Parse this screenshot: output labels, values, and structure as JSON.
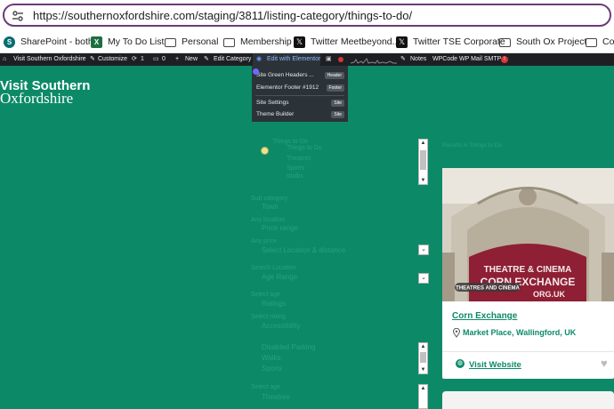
{
  "browser": {
    "url": "https://southernoxfordshire.com/staging/3811/listing-category/things-to-do/",
    "bookmarks": [
      {
        "label": "SharePoint - both",
        "icon": "sharepoint-icon"
      },
      {
        "label": "My To Do List",
        "icon": "excel-icon"
      },
      {
        "label": "Personal",
        "icon": "folder-icon"
      },
      {
        "label": "Membership",
        "icon": "folder-icon"
      },
      {
        "label": "Twitter Meetbeyond...",
        "icon": "x-icon"
      },
      {
        "label": "Twitter TSE Corporate",
        "icon": "x-icon"
      },
      {
        "label": "South Ox Project",
        "icon": "folder-icon"
      },
      {
        "label": "Cor",
        "icon": "folder-icon"
      }
    ]
  },
  "admin_bar": {
    "site_name": "Visit Southern Oxfordshire",
    "customize": "Customize",
    "updates": "1",
    "comments": "0",
    "new": "New",
    "edit_category": "Edit Category",
    "edit_elementor": "Edit with Elementor",
    "notes": "Notes",
    "wpcode": "WPCode",
    "wp_mail_smtp": "WP Mail SMTP",
    "smtp_badge": "!"
  },
  "elementor_dropdown": {
    "items": [
      {
        "label": "Site Green Headers ...",
        "badge": "Header"
      },
      {
        "label": "Elementor Footer #1912",
        "badge": "Footer"
      },
      {
        "label": "Site Settings",
        "badge": "Site"
      },
      {
        "label": "Theme Builder",
        "badge": "Site"
      }
    ]
  },
  "site": {
    "logo_line1": "Visit Southern",
    "logo_line2": "Oxfordshire"
  },
  "sidebar_label": "Results in Things to Do",
  "listing": {
    "title": "Corn Exchange",
    "address": "Market Place, Wallingford, UK",
    "image_sign1": "THEATRE & CINEMA",
    "image_sign2": "CORN EXCHANGE",
    "image_sign3": "ORG.UK",
    "image_tag": "THEATRES AND CINEMA",
    "visit_link": "Visit Website"
  },
  "filter_faint": [
    "Things to Do",
    "Things to Do",
    "Theatres",
    "Sports",
    "Walks",
    "Sub category",
    "Town",
    "Any location",
    "Price range",
    "Any price",
    "Select Location & distance",
    "Search Location",
    "Age Range",
    "Select age",
    "Ratings",
    "Select rating",
    "Accessibility",
    "Disabled Parking"
  ],
  "colors": {
    "page_bg": "#0c8a67",
    "link": "#0c8a67",
    "admin_bar": "#1e1f23",
    "url_outline": "#6d3a7a",
    "smtp_badge": "#d63638"
  }
}
